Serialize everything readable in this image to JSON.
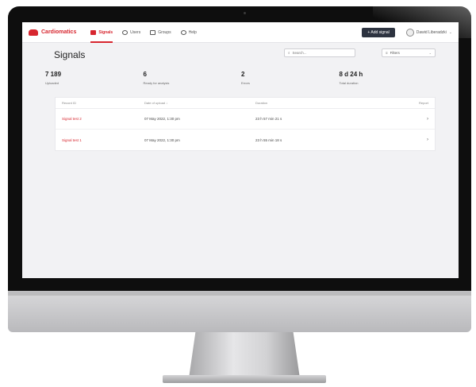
{
  "app": {
    "brand": "Cardiomatics",
    "nav": [
      {
        "label": "Signals",
        "icon": "signal-icon",
        "active": true
      },
      {
        "label": "Users",
        "icon": "users-icon",
        "active": false
      },
      {
        "label": "Groups",
        "icon": "groups-icon",
        "active": false
      },
      {
        "label": "Help",
        "icon": "help-icon",
        "active": false
      }
    ],
    "add_button": "+ Add signal",
    "user_name": "Dawid Liberadzki",
    "accent_color": "#d7262f",
    "dark_button_color": "#2d3340"
  },
  "page": {
    "title": "Signals",
    "search_placeholder": "Search...",
    "filters_label": "Filters"
  },
  "stats": [
    {
      "value": "7 189",
      "label": "Uploaded"
    },
    {
      "value": "6",
      "label": "Ready for analysis"
    },
    {
      "value": "2",
      "label": "Errors"
    },
    {
      "value": "8 d 24 h",
      "label": "Total duration"
    }
  ],
  "table": {
    "headers": [
      "Record ID",
      "Date of upload ↓",
      "Duration",
      "Report"
    ],
    "rows": [
      {
        "id": "Signal test 2",
        "date": "07 May 2022, 1:30 pm",
        "duration": "23 h 57 min 21 s",
        "action": "›"
      },
      {
        "id": "Signal test 1",
        "date": "07 May 2022, 1:30 pm",
        "duration": "23 h 55 min 18 s",
        "action": "›"
      }
    ]
  }
}
